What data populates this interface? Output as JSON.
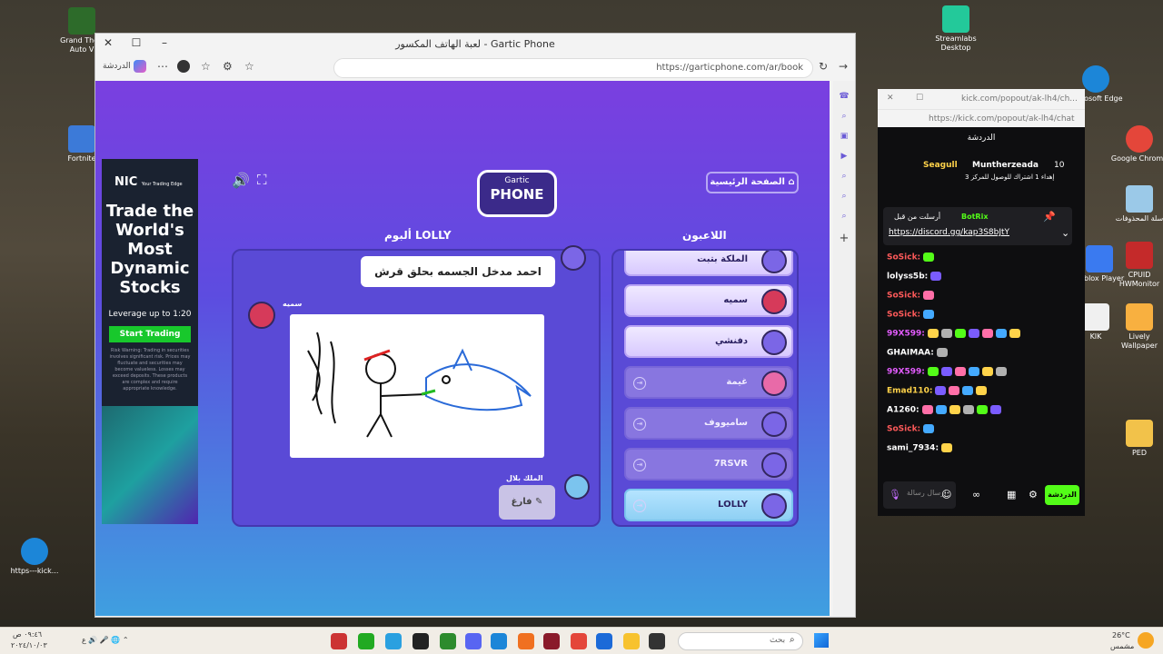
{
  "desktop": {
    "icons": [
      {
        "label": "Grand Theft Auto V",
        "color": "#2d6b2a"
      },
      {
        "label": "Fortnite",
        "color": "#3c7ad8"
      },
      {
        "label": "Streamlabs Desktop",
        "color": "#23c99a"
      },
      {
        "label": "Microsoft Edge",
        "color": "#1c86d8"
      },
      {
        "label": "Google Chrome",
        "color": "#e4463a"
      },
      {
        "label": "سلة المحذوفات",
        "color": "#9bc9e8"
      },
      {
        "label": "Roblox Player",
        "color": "#3a7af0"
      },
      {
        "label": "CPUID HWMonitor",
        "color": "#c42a2a"
      },
      {
        "label": "KIK",
        "color": "#f0f0f0"
      },
      {
        "label": "Lively Wallpaper",
        "color": "#f8b040"
      },
      {
        "label": "PED",
        "color": "#f2c24a"
      },
      {
        "label": "https---kick...",
        "color": "#1c86d8"
      }
    ]
  },
  "browser": {
    "title": "لعبة الهاتف المكسور - Gartic Phone",
    "url": "https://garticphone.com/ar/book",
    "chat_label": "الدردشة"
  },
  "ad": {
    "brand": "NIC",
    "brand_sub": "Your Trading Edge",
    "headline": "Trade the World's Most Dynamic Stocks",
    "leverage": "Leverage up to 1:20",
    "cta": "Start Trading",
    "risk": "Risk Warning: Trading in securities involves significant risk. Prices may fluctuate and securities may become valueless. Losses may exceed deposits. These products are complex and require appropriate knowledge."
  },
  "game": {
    "logo_top": "Gartic",
    "logo_bottom": "PHONE",
    "home": "الصفحة الرئيسية",
    "album_title": "ألبوم LOLLY",
    "players_title": "اللاعبون",
    "phrase": "احمد مدخل الجسمه بحلق قرش",
    "artist": "سميه",
    "next_author": "الملك بلال",
    "empty_btn": "فارغ",
    "players": [
      {
        "name": "الملكة بتبت",
        "state": "on",
        "av": "av"
      },
      {
        "name": "سميه",
        "state": "on",
        "av": "av red"
      },
      {
        "name": "دفنشي",
        "state": "on",
        "av": "av"
      },
      {
        "name": "غيمة",
        "state": "off",
        "av": "av pink"
      },
      {
        "name": "ساميووف",
        "state": "off",
        "av": "av"
      },
      {
        "name": "7RSVR",
        "state": "off",
        "av": "av"
      },
      {
        "name": "LOLLY",
        "state": "me",
        "av": "av"
      }
    ]
  },
  "kick": {
    "url_short": "kick.com/popout/ak-lh4/ch...",
    "url": "https://kick.com/popout/ak-lh4/chat",
    "chat_title": "الدردشة",
    "sub_name": "Seagull",
    "sub_target": "Muntherzeada",
    "sub_count": "10",
    "sub_msg": "إهداء 1 اشتراك للوصول للمركز 3",
    "pinned_by": "أرسلت من قبل",
    "pinned_user": "BotRix",
    "pinned_link": "https://discord.gg/kap3S8bJtY",
    "input_placeholder": "إرسال رسالة",
    "send": "الدردشة",
    "lines": [
      {
        "user": "SoSick:",
        "color": "#ff5a5a",
        "emotes": 1
      },
      {
        "user": "lolyss5b:",
        "color": "#ffffff",
        "emotes": 1
      },
      {
        "user": "SoSick:",
        "color": "#ff5a5a",
        "emotes": 1
      },
      {
        "user": "SoSick:",
        "color": "#ff5a5a",
        "emotes": 1
      },
      {
        "user": "99X599:",
        "color": "#e35cff",
        "emotes": 7
      },
      {
        "user": "GHAIMAA:",
        "color": "#ffffff",
        "emotes": 1
      },
      {
        "user": "99X599:",
        "color": "#e35cff",
        "emotes": 6
      },
      {
        "user": "Emad110:",
        "color": "#ffd34a",
        "emotes": 4
      },
      {
        "user": "A1260:",
        "color": "#ffffff",
        "emotes": 6
      },
      {
        "user": "SoSick:",
        "color": "#ff5a5a",
        "emotes": 1
      },
      {
        "user": "sami_7934:",
        "color": "#ffffff",
        "emotes": 1
      }
    ]
  },
  "taskbar": {
    "search": "بحث",
    "weather_temp": "26°C",
    "weather_desc": "مشمس",
    "time": "٠٩:٤٦ ص",
    "date": "٢٠٢٤/١٠/٠٣"
  }
}
